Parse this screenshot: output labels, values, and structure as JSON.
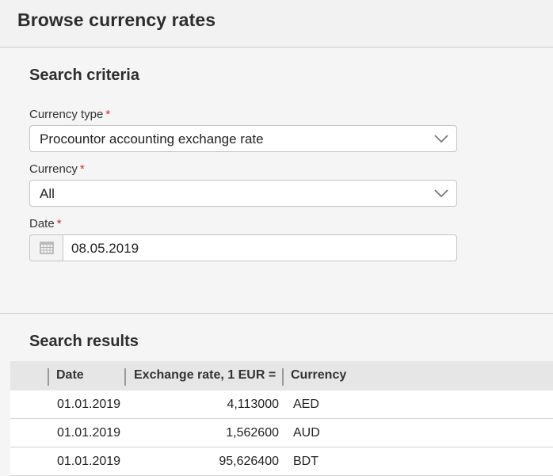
{
  "header": {
    "title": "Browse currency rates"
  },
  "criteria": {
    "title": "Search criteria",
    "currency_type": {
      "label": "Currency type",
      "required": "*",
      "value": "Procountor accounting exchange rate"
    },
    "currency": {
      "label": "Currency",
      "required": "*",
      "value": "All"
    },
    "date": {
      "label": "Date",
      "required": "*",
      "value": "08.05.2019"
    }
  },
  "results": {
    "title": "Search results",
    "columns": {
      "date": "Date",
      "rate": "Exchange rate, 1 EUR =",
      "currency": "Currency"
    },
    "rows": [
      {
        "date": "01.01.2019",
        "rate": "4,113000",
        "currency": "AED"
      },
      {
        "date": "01.01.2019",
        "rate": "1,562600",
        "currency": "AUD"
      },
      {
        "date": "01.01.2019",
        "rate": "95,626400",
        "currency": "BDT"
      }
    ]
  },
  "colors": {
    "required": "#d9262c",
    "border": "#c4c4c4",
    "header_bg": "#e6e6e6"
  },
  "icons": {
    "dropdown": "chevron-down-icon",
    "date": "calendar-icon"
  }
}
